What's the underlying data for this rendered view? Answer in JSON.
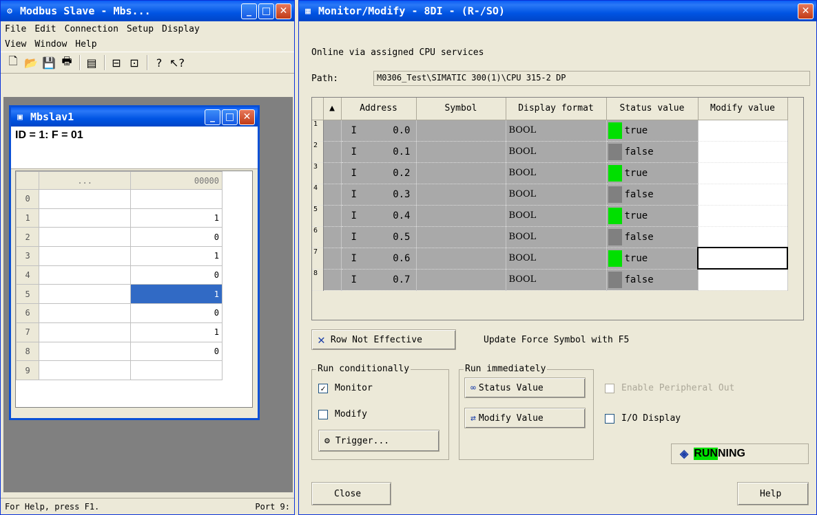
{
  "modbus": {
    "title": "Modbus Slave - Mbs...",
    "menu": [
      "File",
      "Edit",
      "Connection",
      "Setup",
      "Display",
      "View",
      "Window",
      "Help"
    ],
    "child": {
      "title": "Mbslav1",
      "id_line": "ID = 1: F = 01",
      "header": [
        "",
        "...",
        "00000"
      ],
      "rows": [
        {
          "label": "0",
          "value": ""
        },
        {
          "label": "1",
          "value": "1"
        },
        {
          "label": "2",
          "value": "0"
        },
        {
          "label": "3",
          "value": "1"
        },
        {
          "label": "4",
          "value": "0"
        },
        {
          "label": "5",
          "value": "1"
        },
        {
          "label": "6",
          "value": "0"
        },
        {
          "label": "7",
          "value": "1"
        },
        {
          "label": "8",
          "value": "0"
        },
        {
          "label": "9",
          "value": ""
        }
      ]
    },
    "status_left": "For Help, press F1.",
    "status_right": "Port 9:"
  },
  "monitor": {
    "title": "Monitor/Modify - 8DI - (R-/SO)",
    "online_text": "Online via assigned CPU services",
    "path_label": "Path:",
    "path_value": "M0306_Test\\SIMATIC 300(1)\\CPU 315-2 DP",
    "columns": [
      "Address",
      "Symbol",
      "Display format",
      "Status value",
      "Modify value"
    ],
    "rows": [
      {
        "n": "1",
        "type": "I",
        "addr": "0.0",
        "fmt": "BOOL",
        "status": "true",
        "on": true
      },
      {
        "n": "2",
        "type": "I",
        "addr": "0.1",
        "fmt": "BOOL",
        "status": "false",
        "on": false
      },
      {
        "n": "3",
        "type": "I",
        "addr": "0.2",
        "fmt": "BOOL",
        "status": "true",
        "on": true
      },
      {
        "n": "4",
        "type": "I",
        "addr": "0.3",
        "fmt": "BOOL",
        "status": "false",
        "on": false
      },
      {
        "n": "5",
        "type": "I",
        "addr": "0.4",
        "fmt": "BOOL",
        "status": "true",
        "on": true
      },
      {
        "n": "6",
        "type": "I",
        "addr": "0.5",
        "fmt": "BOOL",
        "status": "false",
        "on": false
      },
      {
        "n": "7",
        "type": "I",
        "addr": "0.6",
        "fmt": "BOOL",
        "status": "true",
        "on": true
      },
      {
        "n": "8",
        "type": "I",
        "addr": "0.7",
        "fmt": "BOOL",
        "status": "false",
        "on": false
      }
    ],
    "row_not_effective": "Row Not Effective",
    "update_force": "Update Force Symbol with F5",
    "run_conditionally": "Run conditionally",
    "monitor_label": "Monitor",
    "modify_label": "Modify",
    "trigger_label": "Trigger...",
    "run_immediately": "Run immediately",
    "status_value_btn": "Status Value",
    "modify_value_btn": "Modify Value",
    "enable_peripheral": "Enable Peripheral Out",
    "io_display": "I/O Display",
    "running_hl": "RUN",
    "running_rest": "NING",
    "close": "Close",
    "help": "Help"
  }
}
